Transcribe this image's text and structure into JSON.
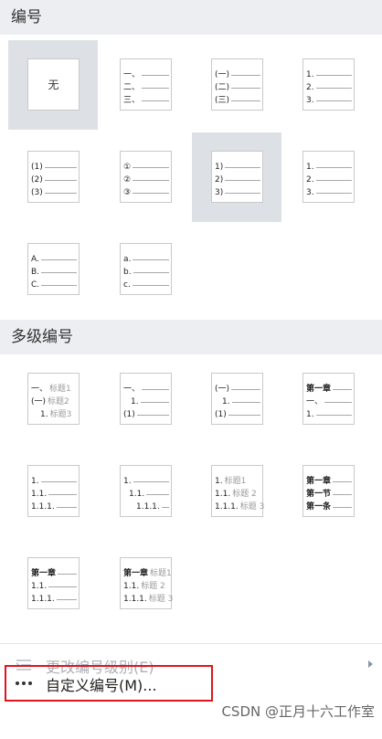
{
  "sections": {
    "numbering_title": "编号",
    "multilevel_title": "多级编号"
  },
  "numbering_styles": [
    {
      "name": "none",
      "label": "无",
      "selected": true,
      "rows": []
    },
    {
      "name": "chinese-dun",
      "selected": false,
      "rows": [
        "一、",
        "二、",
        "三、"
      ]
    },
    {
      "name": "chinese-paren",
      "selected": false,
      "rows": [
        "(一)",
        "(二)",
        "(三)"
      ]
    },
    {
      "name": "arabic-dot",
      "selected": false,
      "rows": [
        "1.",
        "2.",
        "3."
      ]
    },
    {
      "name": "arabic-paren",
      "selected": false,
      "rows": [
        "(1)",
        "(2)",
        "(3)"
      ]
    },
    {
      "name": "circled-number",
      "selected": false,
      "rows": [
        "①",
        "②",
        "③"
      ]
    },
    {
      "name": "arabic-right-paren",
      "selected": true,
      "rows": [
        "1)",
        "2)",
        "3)"
      ]
    },
    {
      "name": "arabic-dot-bold",
      "selected": false,
      "rows": [
        "1.",
        "2.",
        "3."
      ]
    },
    {
      "name": "upper-alpha-dot",
      "selected": false,
      "rows": [
        "A.",
        "B.",
        "C."
      ]
    },
    {
      "name": "lower-alpha-dot",
      "selected": false,
      "rows": [
        "a.",
        "b.",
        "c."
      ]
    }
  ],
  "multilevel_styles": [
    {
      "name": "ml-chinese-heading",
      "rows": [
        [
          "一、",
          "标题1"
        ],
        [
          "(一)",
          "标题2"
        ],
        [
          "1.",
          "标题3"
        ]
      ]
    },
    {
      "name": "ml-chinese-arabic",
      "rows": [
        [
          "一、",
          ""
        ],
        [
          "1.",
          ""
        ],
        [
          "(1)",
          ""
        ]
      ]
    },
    {
      "name": "ml-paren-arabic",
      "rows": [
        [
          "(一)",
          ""
        ],
        [
          "1.",
          ""
        ],
        [
          "(1)",
          ""
        ]
      ]
    },
    {
      "name": "ml-chapter",
      "rows": [
        [
          "第一章",
          ""
        ],
        [
          "一、",
          ""
        ],
        [
          "1.",
          ""
        ]
      ]
    },
    {
      "name": "ml-decimal",
      "rows": [
        [
          "1.",
          ""
        ],
        [
          "1.1.",
          ""
        ],
        [
          "1.1.1.",
          ""
        ]
      ]
    },
    {
      "name": "ml-decimal-indent",
      "rows": [
        [
          "1.",
          ""
        ],
        [
          "1.1.",
          ""
        ],
        [
          "1.1.1.",
          ""
        ]
      ]
    },
    {
      "name": "ml-decimal-heading",
      "rows": [
        [
          "1.",
          "标题1"
        ],
        [
          "1.1.",
          "标题 2"
        ],
        [
          "1.1.1.",
          "标题 3"
        ]
      ]
    },
    {
      "name": "ml-chapter-section",
      "rows": [
        [
          "第一章",
          ""
        ],
        [
          "第一节",
          ""
        ],
        [
          "第一条",
          ""
        ]
      ]
    },
    {
      "name": "ml-chapter-decimal",
      "rows": [
        [
          "第一章",
          ""
        ],
        [
          "1.1.",
          ""
        ],
        [
          "1.1.1.",
          ""
        ]
      ]
    },
    {
      "name": "ml-chapter-decimal-heading",
      "rows": [
        [
          "第一章",
          "标题1"
        ],
        [
          "1.1.",
          "标题 2"
        ],
        [
          "1.1.1.",
          "标题 3"
        ]
      ]
    }
  ],
  "footer": {
    "change_level_label": "更改编号级别(E)",
    "custom_numbering_label": "自定义编号(M)..."
  },
  "watermark": "CSDN @正月十六工作室",
  "colors": {
    "highlight": "#e0141e",
    "selected_bg": "#dde1e6",
    "header_bg": "#eceef1"
  }
}
